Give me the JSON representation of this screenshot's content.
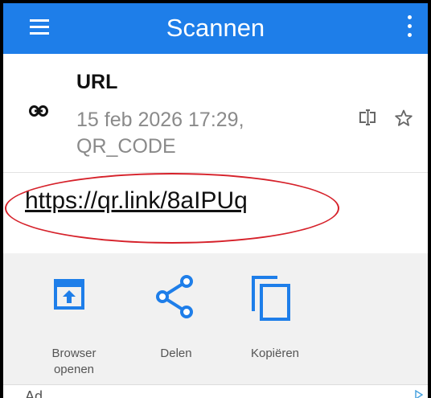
{
  "appbar": {
    "title": "Scannen",
    "menu_icon": "hamburger-menu-icon",
    "overflow_icon": "more-vert-icon",
    "color": "#1e7ee9"
  },
  "scan": {
    "type": "URL",
    "datetime": "15 feb 2026 17:29,",
    "format": "QR_CODE",
    "type_icon": "link-icon",
    "rename_icon": "text-cursor-icon",
    "favorite_icon": "star-outline-icon",
    "url": "https://qr.link/8aIPUq"
  },
  "highlight": {
    "color": "#d6212a"
  },
  "actions": [
    {
      "label_line1": "Browser",
      "label_line2": "openen",
      "icon": "open-in-browser-icon"
    },
    {
      "label_line1": "Delen",
      "label_line2": "",
      "icon": "share-icon"
    },
    {
      "label_line1": "Kopiëren",
      "label_line2": "",
      "icon": "copy-icon"
    }
  ],
  "ad": {
    "text": "Ad"
  }
}
